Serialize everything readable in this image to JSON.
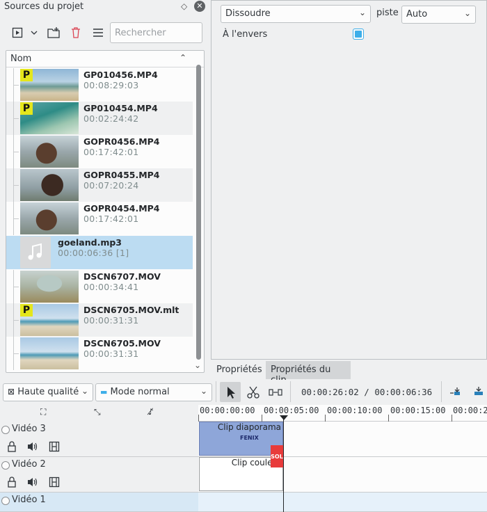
{
  "bin": {
    "title": "Sources du projet",
    "search_placeholder": "Rechercher",
    "column_header": "Nom",
    "clips": [
      {
        "name": "GP010456.MP4",
        "duration": "00:08:29:03",
        "proxy": "P",
        "thumb": "sea"
      },
      {
        "name": "GP010454.MP4",
        "duration": "00:02:24:42",
        "proxy": "P",
        "thumb": "wave"
      },
      {
        "name": "GOPR0456.MP4",
        "duration": "00:17:42:01",
        "thumb": "face"
      },
      {
        "name": "GOPR0455.MP4",
        "duration": "00:07:20:24",
        "thumb": "face2"
      },
      {
        "name": "GOPR0454.MP4",
        "duration": "00:17:42:01",
        "thumb": "face"
      },
      {
        "name": "goeland.mp3",
        "duration": "00:00:06:36  [1]",
        "thumb": "audio",
        "selected": true
      },
      {
        "name": "DSCN6707.MOV",
        "duration": "00:00:34:41",
        "thumb": "sail"
      },
      {
        "name": "DSCN6705.MOV.mlt",
        "duration": "00:00:31:31",
        "proxy": "P",
        "thumb": "beach"
      },
      {
        "name": "DSCN6705.MOV",
        "duration": "00:00:31:31",
        "thumb": "beach"
      }
    ]
  },
  "props": {
    "transition": "Dissoudre",
    "piste_label": "piste",
    "piste_value": "Auto",
    "reverse_label": "À l'envers",
    "reverse_checked": true
  },
  "tabs": {
    "properties": "Propriétés",
    "clip_properties": "Propriétés du clip"
  },
  "toolbar": {
    "quality": "Haute qualité",
    "mode": "Mode normal",
    "timecode": "00:00:26:02 / 00:00:06:36"
  },
  "ruler": {
    "labels": [
      "00:00:00:00",
      "00:00:05:00",
      "00:00:10:00",
      "00:00:15:00",
      "00:00:20"
    ]
  },
  "tracks": [
    {
      "name": "Vidéo 3",
      "clip": "Clip diaporama"
    },
    {
      "name": "Vidéo 2",
      "clip": "Clip couleur"
    },
    {
      "name": "Vidéo 1",
      "clip": ""
    }
  ],
  "slideshow_thumb_text": "FENIX",
  "transition_mark": "SOL",
  "colors": {
    "accent": "#3daee9",
    "selection": "#bcdcf2",
    "proxy_badge": "#e4e61c",
    "slideshow_clip": "#8ea6d9",
    "transition_marker": "#e83b3b"
  }
}
